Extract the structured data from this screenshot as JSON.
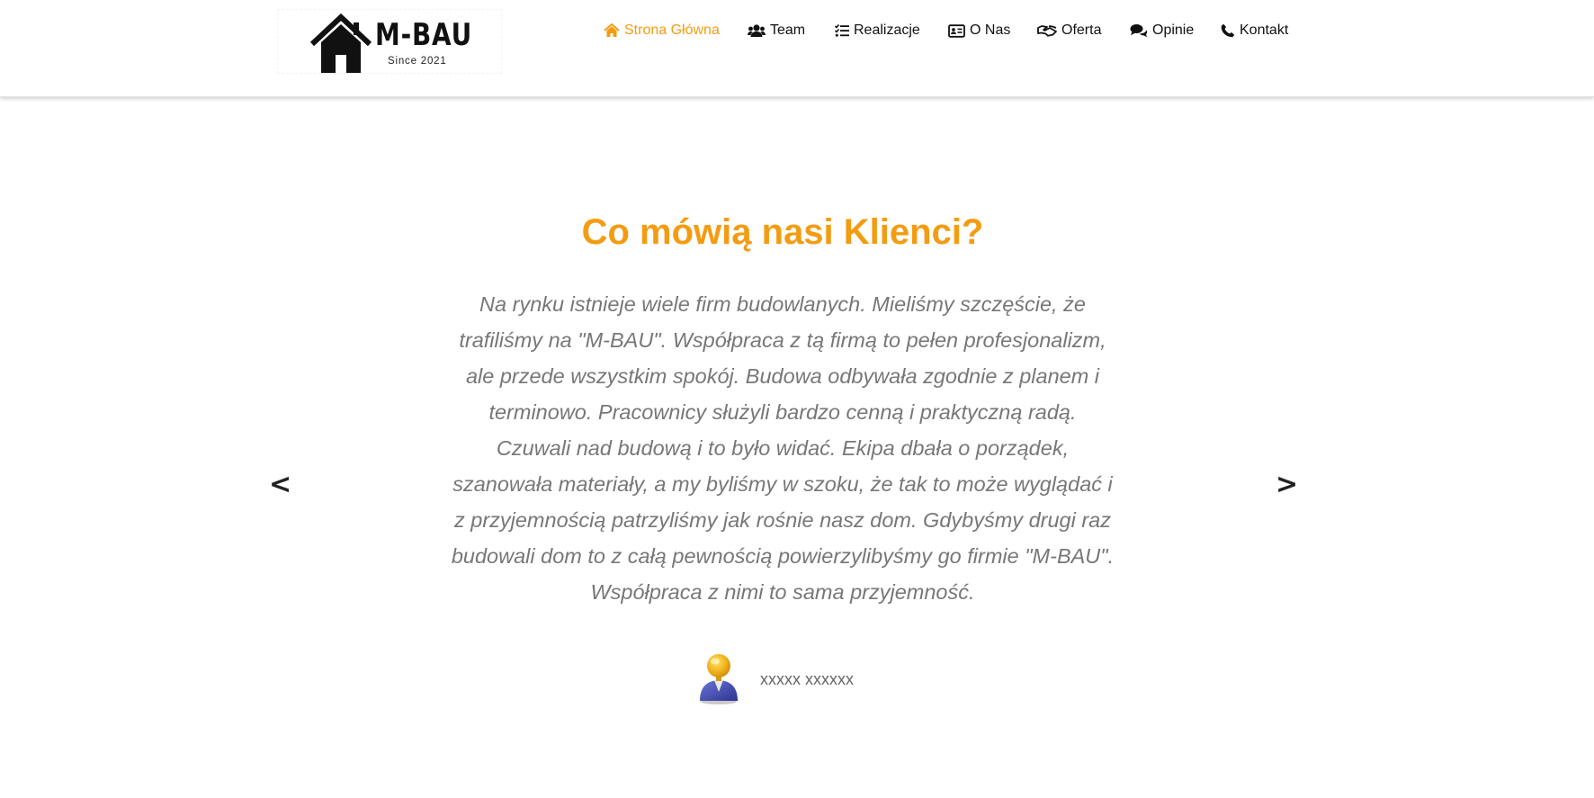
{
  "brand": {
    "name": "M-BAU",
    "tagline": "Since 2021"
  },
  "nav": {
    "items": [
      {
        "label": "Strona Główna",
        "icon": "home-icon",
        "active": true
      },
      {
        "label": "Team",
        "icon": "users-icon",
        "active": false
      },
      {
        "label": "Realizacje",
        "icon": "tasks-icon",
        "active": false
      },
      {
        "label": "O Nas",
        "icon": "id-card-icon",
        "active": false
      },
      {
        "label": "Oferta",
        "icon": "handshake-icon",
        "active": false
      },
      {
        "label": "Opinie",
        "icon": "comments-icon",
        "active": false
      },
      {
        "label": "Kontakt",
        "icon": "phone-icon",
        "active": false
      }
    ]
  },
  "testimonials": {
    "title": "Co mówią nasi Klienci?",
    "quote": "Na rynku istnieje wiele firm budowlanych. Mieliśmy szczęście, że trafiliśmy na \"M-BAU\". Współpraca z tą firmą to pełen profesjonalizm, ale przede wszystkim spokój. Budowa odbywała zgodnie z planem i terminowo. Pracownicy służyli bardzo cenną i praktyczną radą. Czuwali nad budową i to było widać. Ekipa dbała o porządek, szanowała materiały, a my byliśmy w szoku, że tak to może wyglądać i z przyjemnością patrzyliśmy jak rośnie nasz dom. Gdybyśmy drugi raz budowali dom to z całą pewnością powierzylibyśmy go firmie \"M-BAU\". Współpraca z nimi to sama przyjemność.",
    "prev_label": "<",
    "next_label": ">",
    "author": "xxxxx xxxxxx"
  },
  "colors": {
    "accent": "#f39c12",
    "text": "#777777",
    "nav_text": "#111111"
  }
}
